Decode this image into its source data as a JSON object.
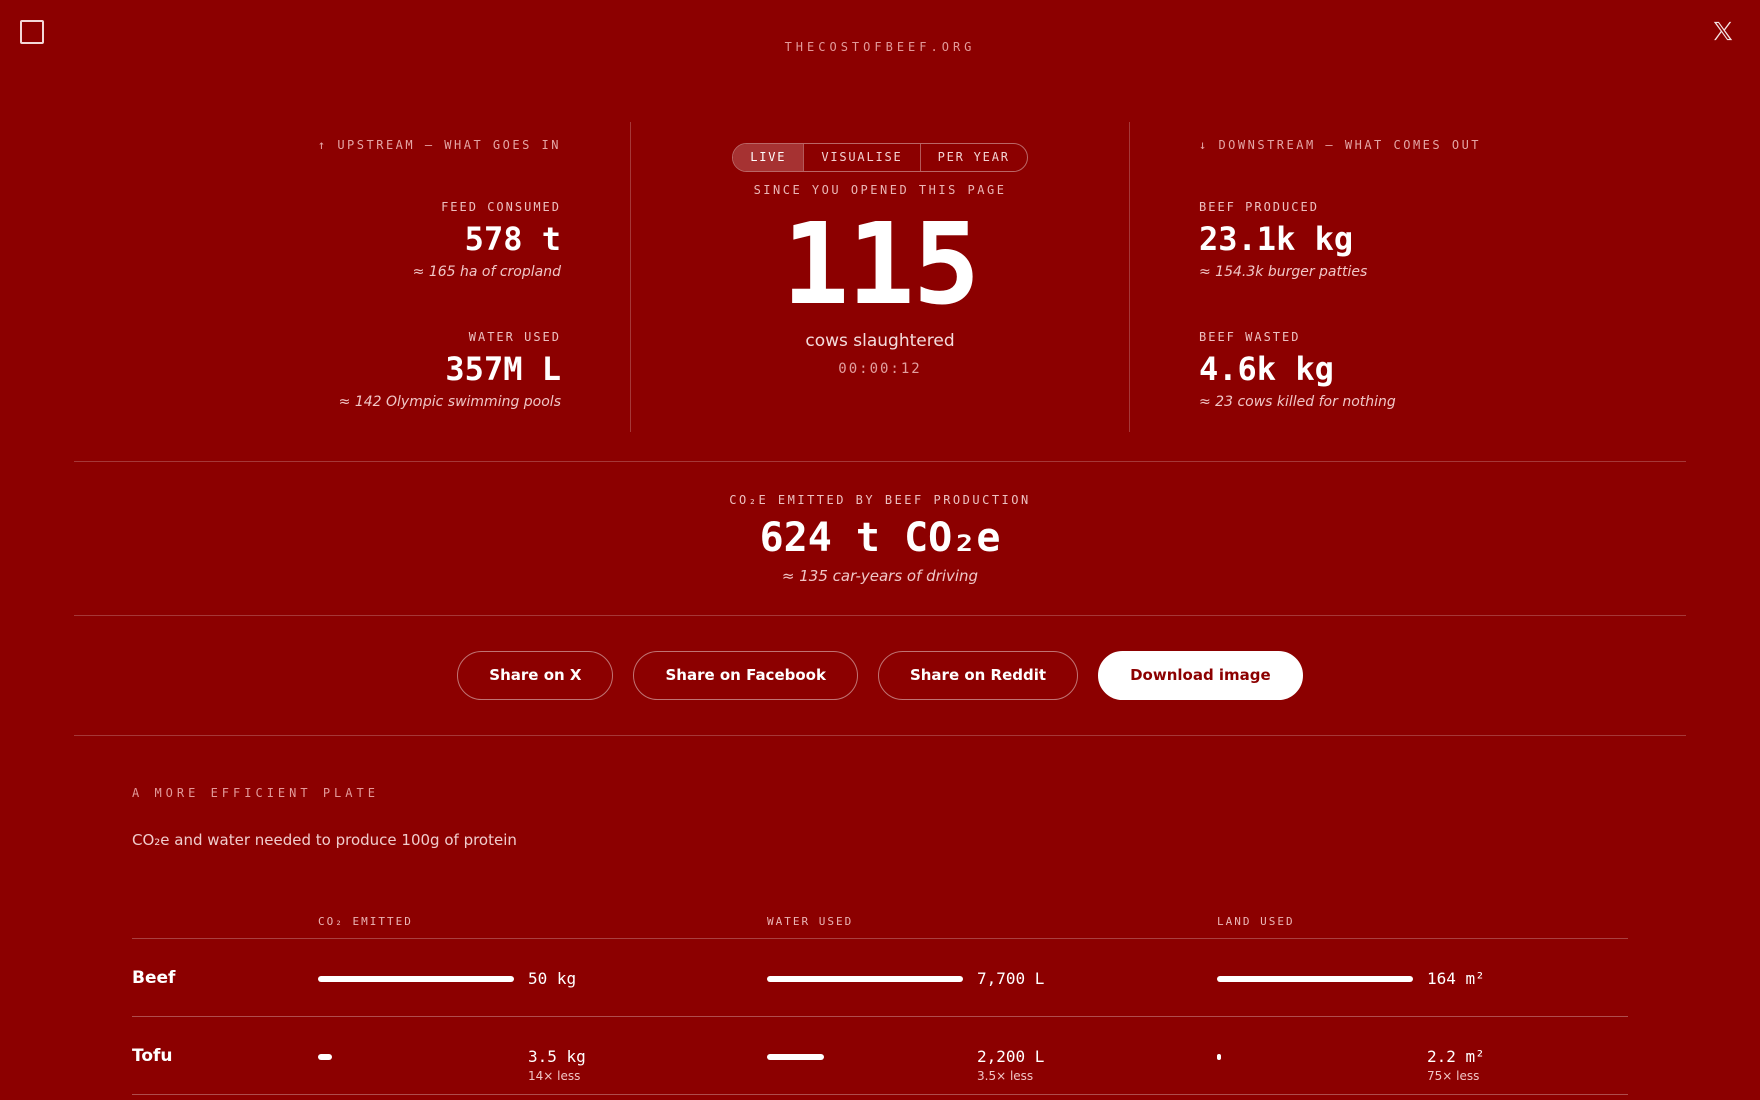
{
  "header": {
    "site": "THECOSTOFBEEF.ORG",
    "menu_icon": "square-icon",
    "close_icon": "x-logo-icon"
  },
  "upstream": {
    "title": "↑ UPSTREAM — WHAT GOES IN",
    "feed": {
      "label": "FEED CONSUMED",
      "value": "578 t",
      "note": "≈ 165 ha of cropland"
    },
    "water": {
      "label": "WATER USED",
      "value": "357M L",
      "note": "≈ 142 Olympic swimming pools"
    }
  },
  "center": {
    "tabs": [
      "LIVE",
      "VISUALISE",
      "PER YEAR"
    ],
    "active_tab": "LIVE",
    "since": "SINCE YOU OPENED THIS PAGE",
    "count": "115",
    "count_label": "cows slaughtered",
    "timer": "00:00:12"
  },
  "downstream": {
    "title": "↓ DOWNSTREAM — WHAT COMES OUT",
    "produced": {
      "label": "BEEF PRODUCED",
      "value": "23.1k kg",
      "note": "≈ 154.3k burger patties"
    },
    "wasted": {
      "label": "BEEF WASTED",
      "value": "4.6k kg",
      "note": "≈ 23 cows killed for nothing"
    }
  },
  "co2": {
    "label": "CO₂E EMITTED BY BEEF PRODUCTION",
    "value": "624 t CO₂e",
    "note": "≈ 135 car-years of driving"
  },
  "share": {
    "x": "Share on X",
    "facebook": "Share on Facebook",
    "reddit": "Share on Reddit",
    "download": "Download image"
  },
  "efficiency": {
    "title": "A MORE EFFICIENT PLATE",
    "subtitle": "CO₂e and water needed to produce 100g of protein",
    "columns": [
      "CO₂ EMITTED",
      "WATER USED",
      "LAND USED"
    ],
    "rows": [
      {
        "food": "Beef",
        "co2": {
          "value": "50 kg",
          "less": "",
          "fraction": 1.0
        },
        "water": {
          "value": "7,700 L",
          "less": "",
          "fraction": 1.0
        },
        "land": {
          "value": "164 m²",
          "less": "",
          "fraction": 1.0
        }
      },
      {
        "food": "Tofu",
        "co2": {
          "value": "3.5 kg",
          "less": "14× less",
          "fraction": 0.07
        },
        "water": {
          "value": "2,200 L",
          "less": "3.5× less",
          "fraction": 0.29
        },
        "land": {
          "value": "2.2 m²",
          "less": "75× less",
          "fraction": 0.013
        }
      }
    ]
  },
  "colors": {
    "background": "#8c0000",
    "text": "#ffffff",
    "muted": "#e29a9a"
  }
}
